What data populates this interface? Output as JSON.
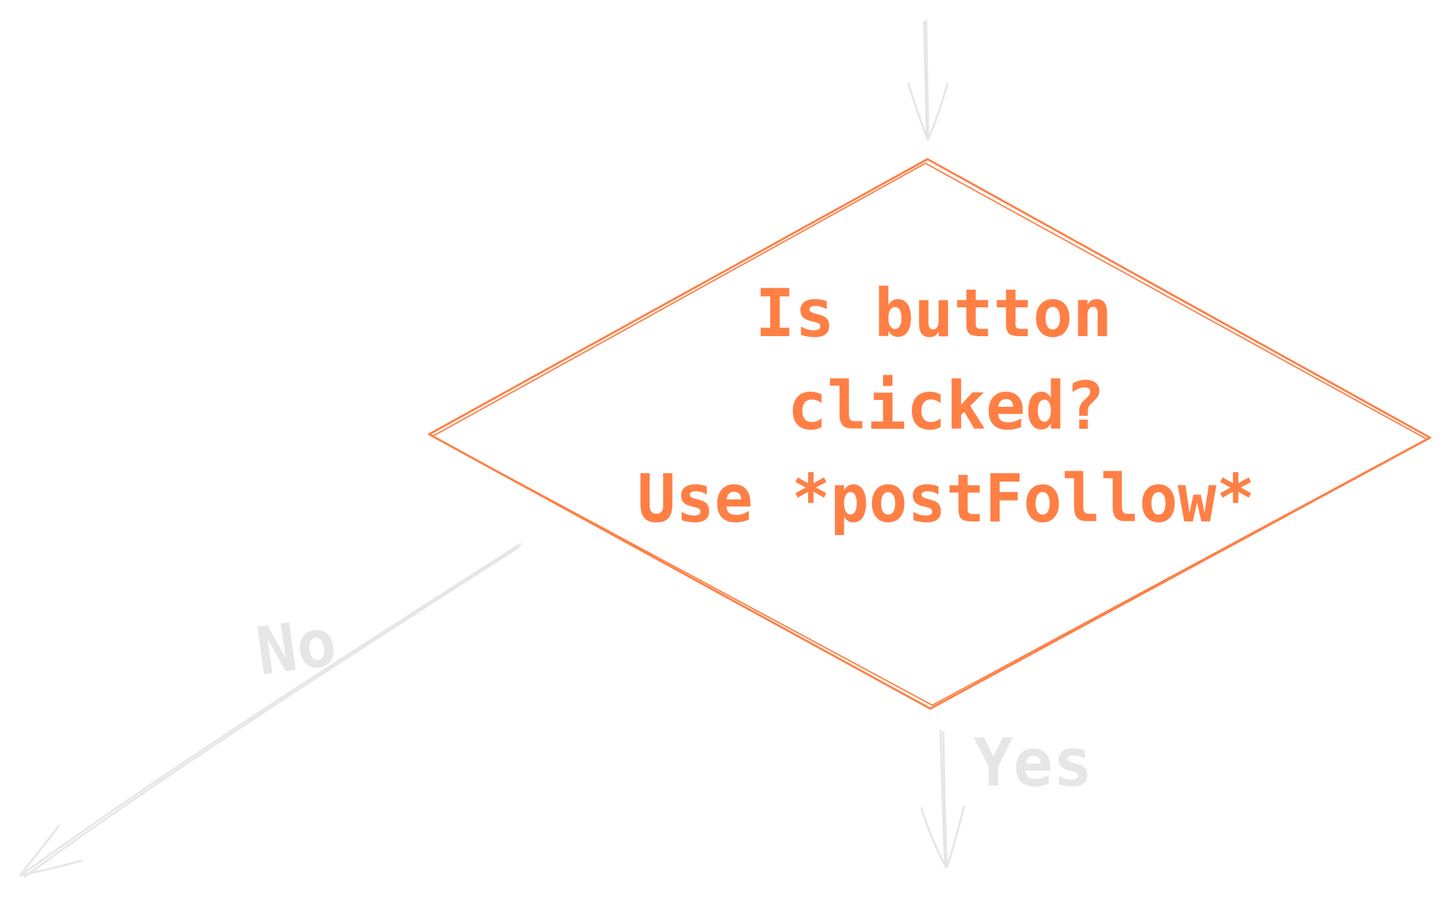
{
  "decision": {
    "lines": [
      "Is button",
      "clicked?",
      "Use *postFollow*"
    ],
    "stroke_color": "#ff7f45",
    "text_color": "#ff7f45"
  },
  "branches": {
    "no_label": "No",
    "yes_label": "Yes"
  },
  "connector_color": "#e6e6e6",
  "background_color": "#ffffff"
}
